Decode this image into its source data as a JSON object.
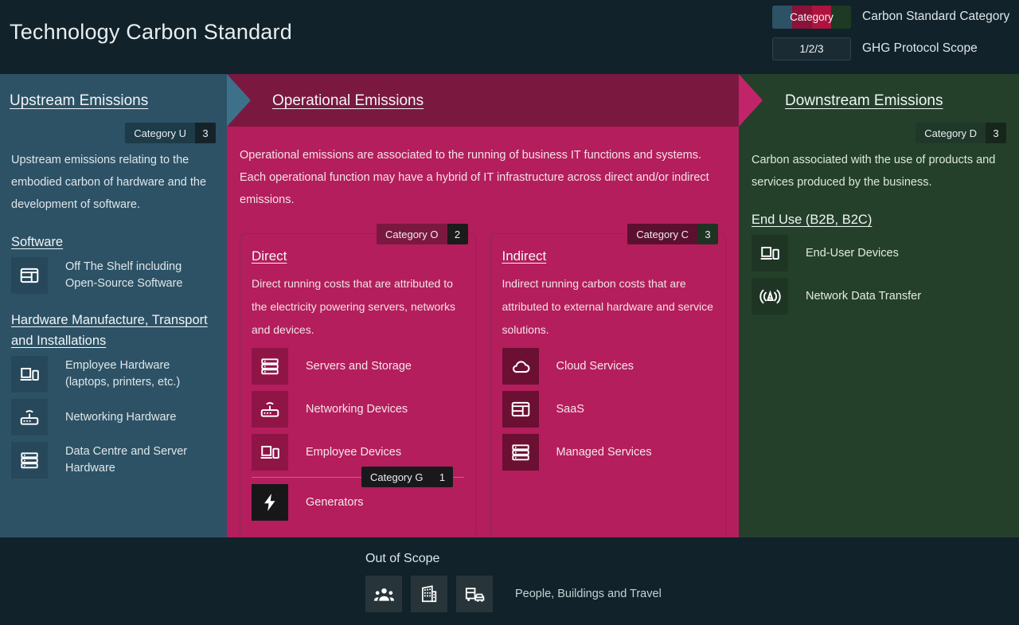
{
  "header": {
    "title": "Technology Carbon Standard",
    "legend": [
      {
        "chip": "Category",
        "label": "Carbon Standard Category",
        "type": "category"
      },
      {
        "chip": "1/2/3",
        "label": "GHG Protocol Scope",
        "type": "scope"
      }
    ]
  },
  "upstream": {
    "title": "Upstream Emissions",
    "badge": {
      "label": "Category U",
      "number": "3"
    },
    "description": "Upstream emissions relating to the embodied carbon of hardware and the development of software.",
    "sections": [
      {
        "title": "Software",
        "items": [
          {
            "icon": "app-window-icon",
            "label": "Off The Shelf including Open-Source Software"
          }
        ]
      },
      {
        "title": "Hardware Manufacture, Transport and Installations",
        "items": [
          {
            "icon": "laptop-phone-icon",
            "label": "Employee Hardware (laptops, printers, etc.)"
          },
          {
            "icon": "router-icon",
            "label": "Networking Hardware"
          },
          {
            "icon": "server-rack-icon",
            "label": "Data Centre and Server Hardware"
          }
        ]
      }
    ]
  },
  "operational": {
    "title": "Operational Emissions",
    "description": "Operational emissions are associated to the running of business IT functions and systems. Each operational function may have a hybrid of IT infrastructure across direct and/or indirect emissions.",
    "cards": [
      {
        "title": "Direct",
        "badge": {
          "label": "Category O",
          "number": "2"
        },
        "description": "Direct running costs that are attributed to the electricity powering servers, networks and devices.",
        "items": [
          {
            "icon": "server-rack-icon",
            "label": "Servers and Storage"
          },
          {
            "icon": "router-icon",
            "label": "Networking Devices"
          },
          {
            "icon": "laptop-phone-icon",
            "label": "Employee Devices"
          }
        ],
        "extra_badge": {
          "label": "Category G",
          "number": "1"
        },
        "extra_items": [
          {
            "icon": "lightning-bolt-icon",
            "label": "Generators"
          }
        ]
      },
      {
        "title": "Indirect",
        "badge": {
          "label": "Category C",
          "number": "3"
        },
        "description": "Indirect running carbon costs that are attributed to external hardware and service solutions.",
        "items": [
          {
            "icon": "cloud-icon",
            "label": "Cloud Services"
          },
          {
            "icon": "app-window-icon",
            "label": "SaaS"
          },
          {
            "icon": "server-rack-icon",
            "label": "Managed Services"
          }
        ]
      }
    ]
  },
  "downstream": {
    "title": "Downstream Emissions",
    "badge": {
      "label": "Category D",
      "number": "3"
    },
    "description": "Carbon associated with the use of products and services produced by the business.",
    "sections": [
      {
        "title": "End Use (B2B, B2C)",
        "items": [
          {
            "icon": "laptop-phone-icon",
            "label": "End-User Devices"
          },
          {
            "icon": "broadcast-antenna-icon",
            "label": "Network Data Transfer"
          }
        ]
      }
    ]
  },
  "out_of_scope": {
    "title": "Out of Scope",
    "icons": [
      "people-group-icon",
      "building-icon",
      "bus-car-icon"
    ],
    "label": "People, Buildings and Travel"
  },
  "colors": {
    "upstream": "#2d5266",
    "operational": "#b41e5c",
    "operational_header": "#7a1840",
    "downstream": "#24402a",
    "page_background": "#11222a"
  }
}
